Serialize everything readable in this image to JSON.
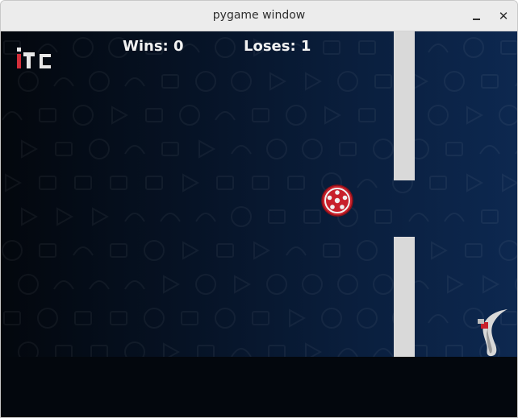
{
  "window": {
    "title": "pygame window",
    "minimize_icon": "minimize-icon",
    "close_icon": "close-icon",
    "close_glyph": "✕"
  },
  "game": {
    "wins_label": "Wins: 0",
    "loses_label": "Loses: 1",
    "logo_icon": "itc-logo",
    "player_icon": "soccer-ball-icon",
    "trophy_icon": "trophy-emblem-icon",
    "colors": {
      "background_dark": "#03070d",
      "background_light": "#0d2850",
      "pipe": "#d9d9d9",
      "ball": "#c8202b",
      "text": "#f2f2f2"
    }
  }
}
